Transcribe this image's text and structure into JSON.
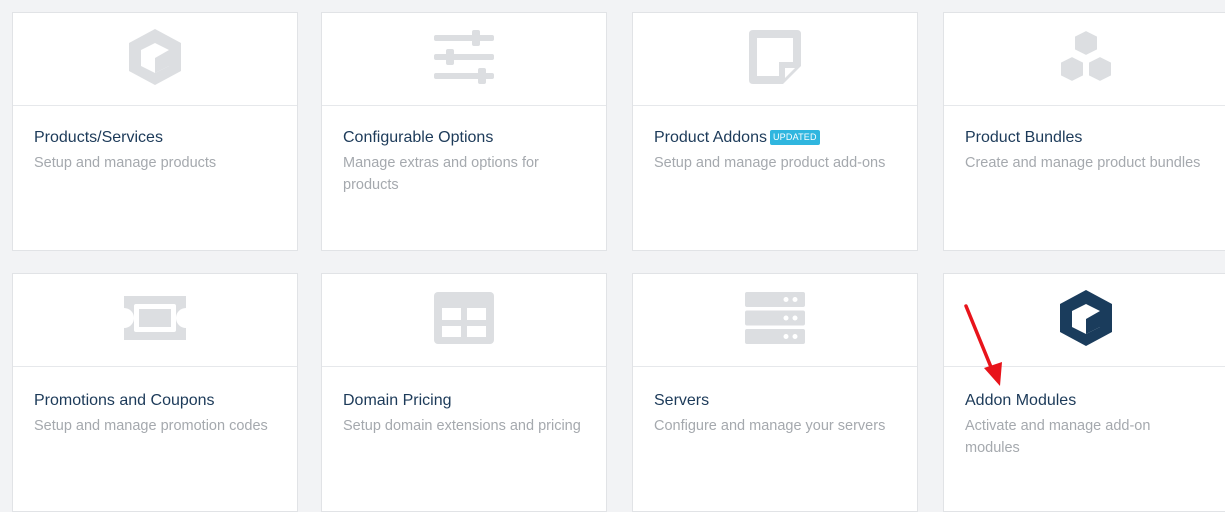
{
  "cards": [
    {
      "title": "Products/Services",
      "description": "Setup and manage products",
      "icon": "box-icon"
    },
    {
      "title": "Configurable Options",
      "description": "Manage extras and options for products",
      "icon": "sliders-icon"
    },
    {
      "title": "Product Addons",
      "badge": "UPDATED",
      "description": "Setup and manage product add-ons",
      "icon": "note-icon"
    },
    {
      "title": "Product Bundles",
      "description": "Create and manage product bundles",
      "icon": "cubes-icon"
    },
    {
      "title": "Promotions and Coupons",
      "description": "Setup and manage promotion codes",
      "icon": "ticket-icon"
    },
    {
      "title": "Domain Pricing",
      "description": "Setup domain extensions and pricing",
      "icon": "table-icon"
    },
    {
      "title": "Servers",
      "description": "Configure and manage your servers",
      "icon": "server-icon"
    },
    {
      "title": "Addon Modules",
      "description": "Activate and manage add-on modules",
      "icon": "box-icon"
    }
  ],
  "colors": {
    "icon_muted": "#dcdee1",
    "icon_active": "#1a3c5c",
    "title": "#1c3a59",
    "description": "#a5a9ae",
    "badge": "#2fb6df",
    "arrow": "#e8141b"
  }
}
